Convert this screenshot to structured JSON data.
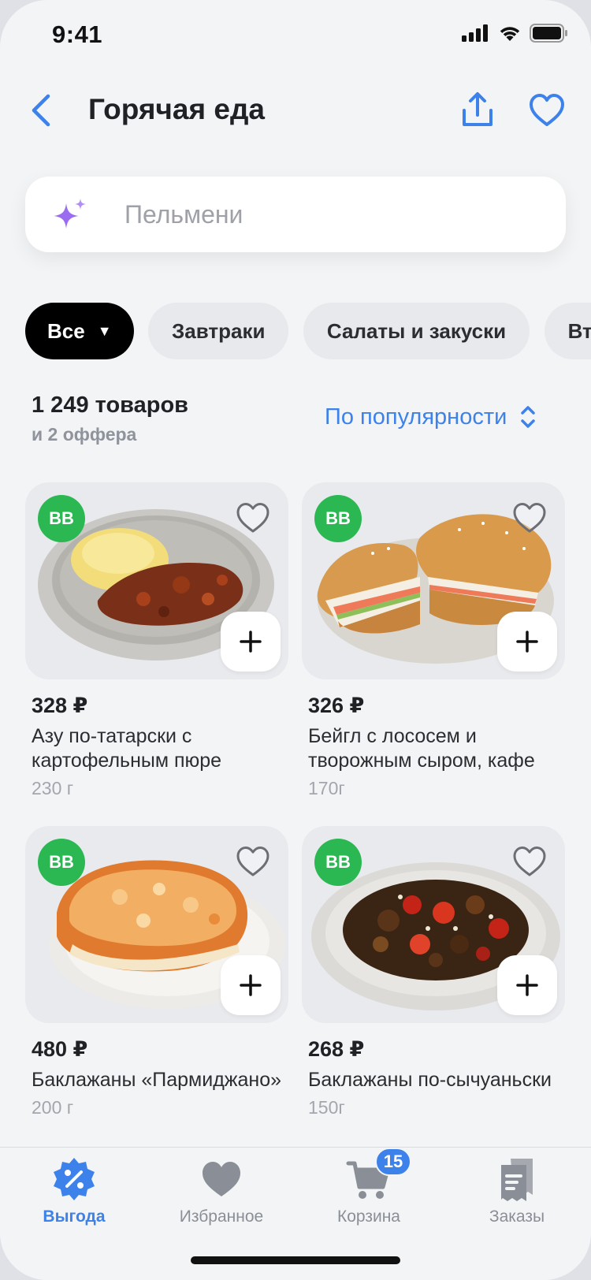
{
  "status_bar": {
    "time": "9:41"
  },
  "header": {
    "title": "Горячая еда",
    "icons": [
      "chevron-left-icon",
      "share-icon",
      "heart-icon"
    ]
  },
  "search": {
    "placeholder": "Пельмени",
    "icon": "sparkle-icon",
    "accent": "#9b6bf0"
  },
  "chips": [
    {
      "label": "Все",
      "active": true
    },
    {
      "label": "Завтраки",
      "active": false
    },
    {
      "label": "Салаты и закуски",
      "active": false
    },
    {
      "label": "Вто",
      "active": false
    }
  ],
  "summary": {
    "count": "1 249 товаров",
    "offers": "и 2 оффера",
    "sort_label": "По популярности"
  },
  "badge_label": "BB",
  "products": [
    {
      "price": "328 ₽",
      "name": "Азу по-татарски с картофельным пюре",
      "weight": "230 г"
    },
    {
      "price": "326 ₽",
      "name": "Бейгл с лососем и творожным сыром, кафе",
      "weight": "170г"
    },
    {
      "price": "480 ₽",
      "name": "Баклажаны «Пармиджано»",
      "weight": "200 г"
    },
    {
      "price": "268 ₽",
      "name": "Баклажаны по-сычуаньски",
      "weight": "150г"
    }
  ],
  "tabbar": {
    "items": [
      {
        "label": "Выгода",
        "icon": "discount-badge-icon",
        "active": true
      },
      {
        "label": "Избранное",
        "icon": "heart-icon",
        "active": false
      },
      {
        "label": "Корзина",
        "icon": "cart-icon",
        "active": false,
        "badge": "15"
      },
      {
        "label": "Заказы",
        "icon": "receipt-icon",
        "active": false
      }
    ]
  },
  "colors": {
    "accent": "#3c82ea",
    "badge_green": "#2bb852",
    "background": "#f3f4f6"
  }
}
